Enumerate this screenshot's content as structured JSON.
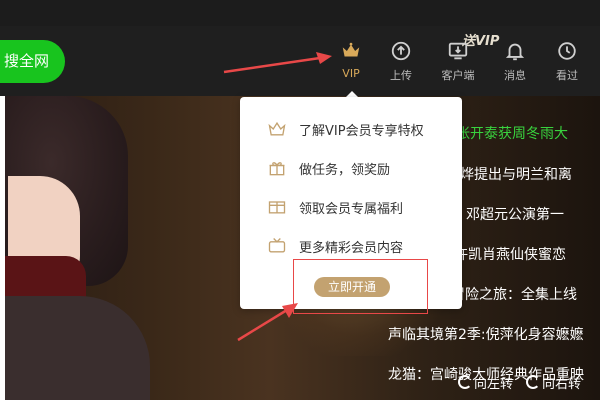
{
  "header": {
    "search_label": "搜全网",
    "promo_label": "送VIP",
    "nav": [
      {
        "label": "VIP",
        "icon": "crown-icon"
      },
      {
        "label": "上传",
        "icon": "upload-icon"
      },
      {
        "label": "客户端",
        "icon": "download-client-icon"
      },
      {
        "label": "消息",
        "icon": "bell-icon"
      },
      {
        "label": "看过",
        "icon": "history-icon"
      }
    ]
  },
  "vip_popup": {
    "items": [
      {
        "label": "了解VIP会员专享特权",
        "icon": "crown-outline-icon"
      },
      {
        "label": "做任务，领奖励",
        "icon": "gift-icon"
      },
      {
        "label": "领取会员专属福利",
        "icon": "coupon-icon"
      },
      {
        "label": "更多精彩会员内容",
        "icon": "tv-icon"
      }
    ],
    "open_button": "立即开通"
  },
  "news_list": [
    "张开泰获周冬雨大",
    "烨提出与明兰和离",
    "邓超元公演第一",
    "许凯肖燕仙侠蜜恋",
    "冒险之旅：全集上线",
    "声临其境第2季:倪萍化身容嬷嬷",
    "龙猫：宫崎骏大师经典作品重映"
  ],
  "rotate": {
    "left_label": "向左转",
    "right_label": "向右转"
  },
  "colors": {
    "accent_green": "#18c41e",
    "vip_gold": "#c3a270",
    "annotation_red": "#e84848"
  }
}
